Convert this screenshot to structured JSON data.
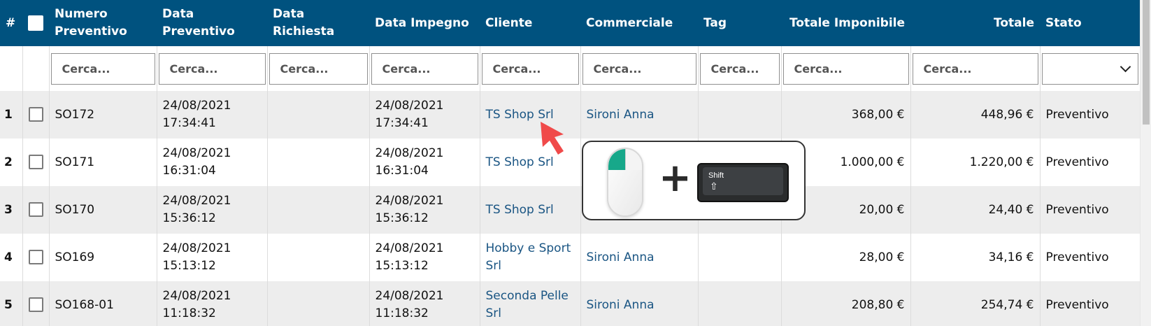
{
  "table": {
    "headers": {
      "num": "#",
      "numero_preventivo": "Numero Preventivo",
      "data_preventivo": "Data Preventivo",
      "data_richiesta": "Data Richiesta",
      "data_impegno": "Data Impegno",
      "cliente": "Cliente",
      "commerciale": "Commerciale",
      "tag": "Tag",
      "totale_imponibile": "Totale Imponibile",
      "totale": "Totale",
      "stato": "Stato"
    },
    "filter_placeholder": "Cerca...",
    "rows": [
      {
        "n": "1",
        "numero": "SO172",
        "data_prev_date": "24/08/2021",
        "data_prev_time": "17:34:41",
        "data_rich": "",
        "data_imp_date": "24/08/2021",
        "data_imp_time": "17:34:41",
        "cliente": "TS Shop Srl",
        "commerciale": "Sironi Anna",
        "tag": "",
        "tot_imp": "368,00 €",
        "totale": "448,96 €",
        "stato": "Preventivo"
      },
      {
        "n": "2",
        "numero": "SO171",
        "data_prev_date": "24/08/2021",
        "data_prev_time": "16:31:04",
        "data_rich": "",
        "data_imp_date": "24/08/2021",
        "data_imp_time": "16:31:04",
        "cliente": "TS Shop Srl",
        "commerciale": "",
        "tag": "",
        "tot_imp": "1.000,00 €",
        "totale": "1.220,00 €",
        "stato": "Preventivo"
      },
      {
        "n": "3",
        "numero": "SO170",
        "data_prev_date": "24/08/2021",
        "data_prev_time": "15:36:12",
        "data_rich": "",
        "data_imp_date": "24/08/2021",
        "data_imp_time": "15:36:12",
        "cliente": "TS Shop Srl",
        "commerciale": "",
        "tag": "",
        "tot_imp": "20,00 €",
        "totale": "24,40 €",
        "stato": "Preventivo"
      },
      {
        "n": "4",
        "numero": "SO169",
        "data_prev_date": "24/08/2021",
        "data_prev_time": "15:13:12",
        "data_rich": "",
        "data_imp_date": "24/08/2021",
        "data_imp_time": "15:13:12",
        "cliente": "Hobby e Sport Srl",
        "commerciale": "Sironi Anna",
        "tag": "",
        "tot_imp": "28,00 €",
        "totale": "34,16 €",
        "stato": "Preventivo"
      },
      {
        "n": "5",
        "numero": "SO168-01",
        "data_prev_date": "24/08/2021",
        "data_prev_time": "11:18:32",
        "data_rich": "",
        "data_imp_date": "24/08/2021",
        "data_imp_time": "11:18:32",
        "cliente": "Seconda Pelle Srl",
        "commerciale": "Sironi Anna",
        "tag": "",
        "tot_imp": "208,80 €",
        "totale": "254,74 €",
        "stato": "Preventivo"
      }
    ]
  },
  "hint": {
    "key_label": "Shift",
    "key_symbol": "⇧",
    "plus": "+",
    "mouse_icon": "mouse-left-click-icon",
    "accent_color": "#17a88a"
  },
  "colors": {
    "header_bg": "#00527f",
    "link": "#1a5583",
    "row_alt": "#ededed",
    "cursor": "#f04a4a"
  }
}
